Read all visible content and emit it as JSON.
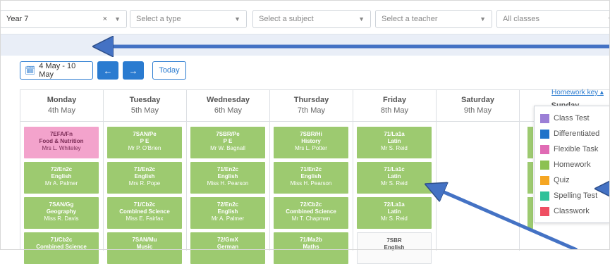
{
  "filters": {
    "year": {
      "value": "Year 7",
      "clear": "×"
    },
    "type": {
      "placeholder": "Select a type"
    },
    "subject": {
      "placeholder": "Select a subject"
    },
    "teacher": {
      "placeholder": "Select a teacher"
    },
    "classes": {
      "placeholder": "All classes"
    }
  },
  "toolbar": {
    "date_range": "4 May - 10 May",
    "prev": "←",
    "next": "→",
    "today": "Today"
  },
  "days": [
    {
      "name": "Monday",
      "date": "4th May"
    },
    {
      "name": "Tuesday",
      "date": "5th May"
    },
    {
      "name": "Wednesday",
      "date": "6th May"
    },
    {
      "name": "Thursday",
      "date": "7th May"
    },
    {
      "name": "Friday",
      "date": "8th May"
    },
    {
      "name": "Saturday",
      "date": "9th May"
    },
    {
      "name": "Sunday",
      "date": ""
    }
  ],
  "tasks": {
    "monday": [
      {
        "class": "7EFA/Fn",
        "subject": "Food & Nutrition",
        "teacher": "Mrs L. Whiteley",
        "type": "Flexible Task"
      },
      {
        "class": "72/En2c",
        "subject": "English",
        "teacher": "Mr A. Palmer",
        "type": "Homework"
      },
      {
        "class": "7SAN/Gg",
        "subject": "Geography",
        "teacher": "Miss R. Davis",
        "type": "Homework"
      },
      {
        "class": "71/Cb2c",
        "subject": "Combined Science",
        "teacher": "",
        "type": "Homework"
      }
    ],
    "tuesday": [
      {
        "class": "7SAN/Pe",
        "subject": "P E",
        "teacher": "Mr P. O'Brien",
        "type": "Homework"
      },
      {
        "class": "71/En2c",
        "subject": "English",
        "teacher": "Mrs R. Pope",
        "type": "Homework"
      },
      {
        "class": "71/Cb2c",
        "subject": "Combined Science",
        "teacher": "Miss E. Fairfax",
        "type": "Homework"
      },
      {
        "class": "7SAN/Mu",
        "subject": "Music",
        "teacher": "",
        "type": "Homework"
      }
    ],
    "wednesday": [
      {
        "class": "7SBR/Pe",
        "subject": "P E",
        "teacher": "Mr W. Bagnall",
        "type": "Homework"
      },
      {
        "class": "71/En2c",
        "subject": "English",
        "teacher": "Miss H. Pearson",
        "type": "Homework"
      },
      {
        "class": "72/En2c",
        "subject": "English",
        "teacher": "Mr A. Palmer",
        "type": "Homework"
      },
      {
        "class": "72/GmX",
        "subject": "German",
        "teacher": "",
        "type": "Homework"
      }
    ],
    "thursday": [
      {
        "class": "7SBR/Hi",
        "subject": "History",
        "teacher": "Mrs L. Potter",
        "type": "Homework"
      },
      {
        "class": "71/En2c",
        "subject": "English",
        "teacher": "Miss H. Pearson",
        "type": "Homework"
      },
      {
        "class": "72/Cb2c",
        "subject": "Combined Science",
        "teacher": "Mr T. Chapman",
        "type": "Homework"
      },
      {
        "class": "71/Ma2b",
        "subject": "Maths",
        "teacher": "",
        "type": "Homework"
      }
    ],
    "friday": [
      {
        "class": "71/La1a",
        "subject": "Latin",
        "teacher": "Mr S. Reid",
        "type": "Homework"
      },
      {
        "class": "71/La1c",
        "subject": "Latin",
        "teacher": "Mr S. Reid",
        "type": "Homework"
      },
      {
        "class": "72/La1a",
        "subject": "Latin",
        "teacher": "Mr S. Reid",
        "type": "Homework"
      },
      {
        "class": "7SBR",
        "subject": "English",
        "teacher": "",
        "type": "Classwork"
      }
    ]
  },
  "homework_key": {
    "link": "Homework key ▴",
    "items": [
      {
        "label": "Class Test",
        "color": "#9b7fd6"
      },
      {
        "label": "Differentiated",
        "color": "#1f73c9"
      },
      {
        "label": "Flexible Task",
        "color": "#e06bb4"
      },
      {
        "label": "Homework",
        "color": "#8cc152"
      },
      {
        "label": "Quiz",
        "color": "#f5a623"
      },
      {
        "label": "Spelling Test",
        "color": "#2fc19a"
      },
      {
        "label": "Classwork",
        "color": "#ef4f63"
      }
    ]
  }
}
